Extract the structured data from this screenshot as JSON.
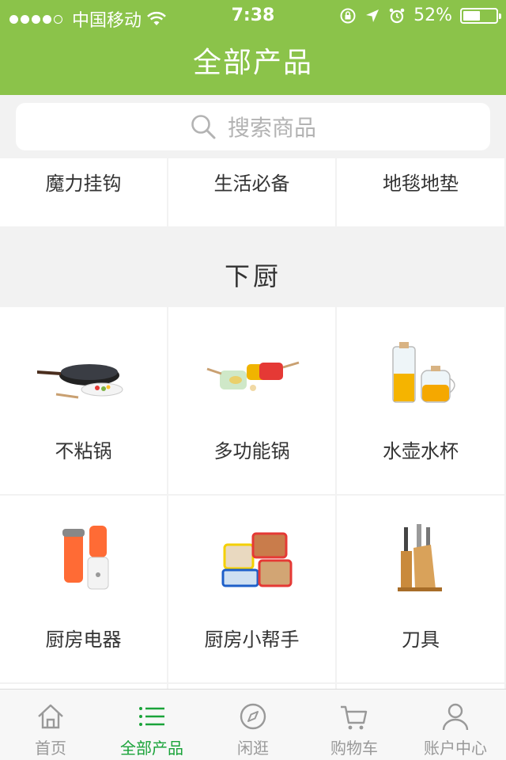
{
  "status_bar": {
    "carrier": "中国移动",
    "time": "7:38",
    "battery": "52%",
    "battery_level": 0.52,
    "signal_bars_filled": 4,
    "signal_bars_total": 5
  },
  "header": {
    "title": "全部产品"
  },
  "search": {
    "placeholder": "搜索商品"
  },
  "top_row": [
    {
      "label": "魔力挂钩"
    },
    {
      "label": "生活必备"
    },
    {
      "label": "地毯地垫"
    }
  ],
  "section": {
    "title": "下厨",
    "items": [
      {
        "label": "不粘锅",
        "icon": "wok-pan-icon"
      },
      {
        "label": "多功能锅",
        "icon": "pot-set-icon"
      },
      {
        "label": "水壶水杯",
        "icon": "glass-pitcher-icon"
      },
      {
        "label": "厨房电器",
        "icon": "blender-icon"
      },
      {
        "label": "厨房小帮手",
        "icon": "food-container-icon"
      },
      {
        "label": "刀具",
        "icon": "knife-block-icon"
      }
    ]
  },
  "tabbar": {
    "tabs": [
      {
        "label": "首页",
        "icon": "home-icon",
        "active": false
      },
      {
        "label": "全部产品",
        "icon": "list-icon",
        "active": true
      },
      {
        "label": "闲逛",
        "icon": "compass-icon",
        "active": false
      },
      {
        "label": "购物车",
        "icon": "cart-icon",
        "active": false
      },
      {
        "label": "账户中心",
        "icon": "user-icon",
        "active": false
      }
    ]
  },
  "colors": {
    "brand_green": "#8bc34a",
    "active_tab": "#1aa33a",
    "background": "#f2f2f2"
  }
}
